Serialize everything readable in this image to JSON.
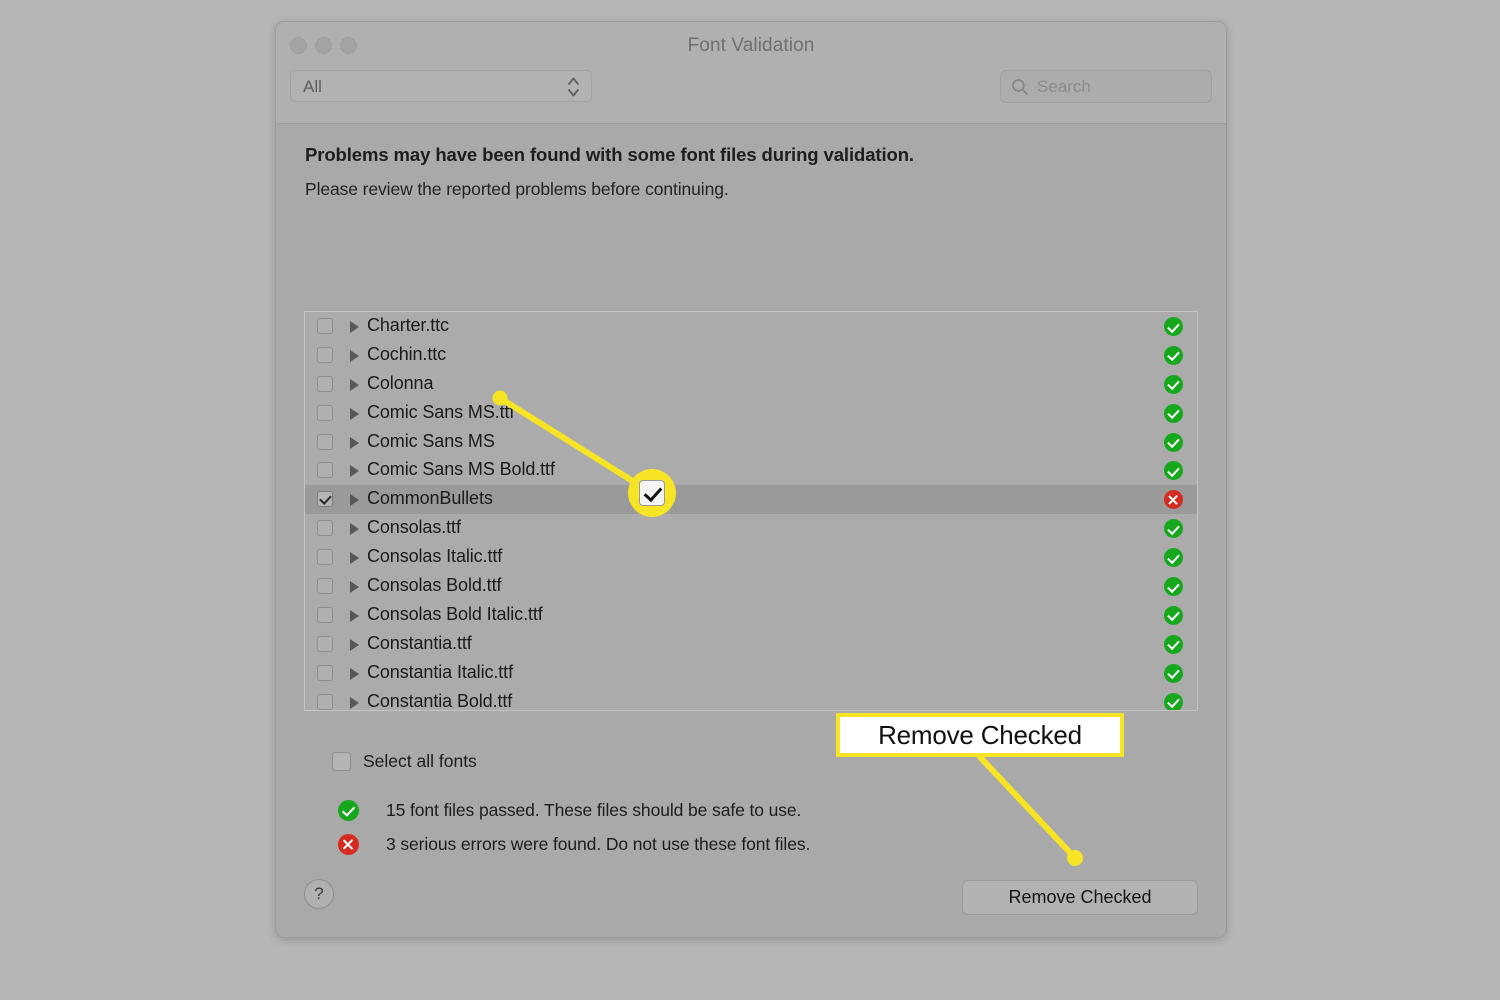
{
  "window": {
    "title": "Font Validation",
    "traffic_lights": [
      "close-button",
      "minimize-button",
      "zoom-button"
    ]
  },
  "toolbar": {
    "filter": {
      "selected": "All",
      "options": [
        "All"
      ]
    },
    "search": {
      "placeholder": "Search",
      "value": "",
      "icon": "search-icon"
    }
  },
  "header": {
    "title": "Problems may have been found with some font files during validation.",
    "subtitle": "Please review the reported problems before continuing."
  },
  "font_list": {
    "rows": [
      {
        "name": "Charter.ttc",
        "checked": false,
        "selected": false,
        "status": "ok"
      },
      {
        "name": "Cochin.ttc",
        "checked": false,
        "selected": false,
        "status": "ok"
      },
      {
        "name": "Colonna",
        "checked": false,
        "selected": false,
        "status": "ok"
      },
      {
        "name": "Comic Sans MS.ttf",
        "checked": false,
        "selected": false,
        "status": "ok"
      },
      {
        "name": "Comic Sans MS",
        "checked": false,
        "selected": false,
        "status": "ok"
      },
      {
        "name": "Comic Sans MS Bold.ttf",
        "checked": false,
        "selected": false,
        "status": "ok"
      },
      {
        "name": "CommonBullets",
        "checked": true,
        "selected": true,
        "status": "error"
      },
      {
        "name": "Consolas.ttf",
        "checked": false,
        "selected": false,
        "status": "ok"
      },
      {
        "name": "Consolas Italic.ttf",
        "checked": false,
        "selected": false,
        "status": "ok"
      },
      {
        "name": "Consolas Bold.ttf",
        "checked": false,
        "selected": false,
        "status": "ok"
      },
      {
        "name": "Consolas Bold Italic.ttf",
        "checked": false,
        "selected": false,
        "status": "ok"
      },
      {
        "name": "Constantia.ttf",
        "checked": false,
        "selected": false,
        "status": "ok"
      },
      {
        "name": "Constantia Italic.ttf",
        "checked": false,
        "selected": false,
        "status": "ok"
      },
      {
        "name": "Constantia Bold.ttf",
        "checked": false,
        "selected": false,
        "status": "ok"
      }
    ]
  },
  "select_all": {
    "label": "Select all fonts",
    "checked": false
  },
  "summary": [
    {
      "status": "ok",
      "text": "15 font files passed. These files should be safe to use."
    },
    {
      "status": "error",
      "text": "3 serious errors were found. Do not use these font files."
    }
  ],
  "footer": {
    "help_label": "?",
    "remove_button": "Remove Checked"
  },
  "annotations": {
    "callout_label": "Remove Checked",
    "highlight_color": "#f7e424",
    "magnified_checkbox_checked": true
  },
  "colors": {
    "desktop_background": "#b6b6b6",
    "window_background": "#a9a9a9",
    "titlebar": "#b0b0b0",
    "selected_row": "#9a9a9a",
    "status_ok": "#16a81c",
    "status_error": "#d42c20",
    "annotation_yellow": "#f7e424"
  }
}
